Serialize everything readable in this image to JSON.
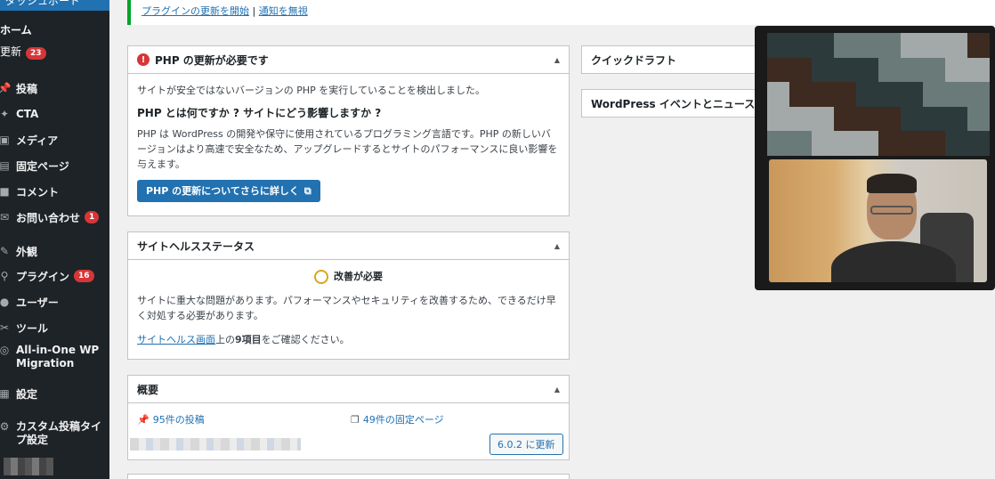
{
  "sidebar": {
    "top_label": "ダッシュボード",
    "home_label": "ホーム",
    "updates_label": "更新",
    "updates_count": "23",
    "items": [
      {
        "label": "投稿",
        "icon": "pin-icon",
        "glyph": "📌",
        "badge": ""
      },
      {
        "label": "CTA",
        "icon": "pin-icon",
        "glyph": "✦",
        "badge": ""
      },
      {
        "label": "メディア",
        "icon": "media-icon",
        "glyph": "▣",
        "badge": ""
      },
      {
        "label": "固定ページ",
        "icon": "page-icon",
        "glyph": "▤",
        "badge": ""
      },
      {
        "label": "コメント",
        "icon": "comment-icon",
        "glyph": "■",
        "badge": ""
      },
      {
        "label": "お問い合わせ",
        "icon": "mail-icon",
        "glyph": "✉",
        "badge": "1"
      },
      {
        "label": "外観",
        "icon": "brush-icon",
        "glyph": "✎",
        "badge": ""
      },
      {
        "label": "プラグイン",
        "icon": "plugin-icon",
        "glyph": "⚲",
        "badge": "16"
      },
      {
        "label": "ユーザー",
        "icon": "user-icon",
        "glyph": "●",
        "badge": ""
      },
      {
        "label": "ツール",
        "icon": "wrench-icon",
        "glyph": "✂",
        "badge": ""
      },
      {
        "label": "All-in-One WP",
        "label2": "Migration",
        "icon": "migration-icon",
        "glyph": "◎",
        "badge": ""
      },
      {
        "label": "設定",
        "icon": "settings-icon",
        "glyph": "▦",
        "badge": ""
      },
      {
        "label": "カスタム投稿タイ",
        "label2": "プ設定",
        "icon": "gear-icon",
        "glyph": "⚙",
        "badge": ""
      }
    ]
  },
  "notice": {
    "link1": "プラグインの更新を開始",
    "separator": "|",
    "link2": "通知を無視"
  },
  "php_box": {
    "title": "PHP の更新が必要です",
    "intro": "サイトが安全ではないバージョンの PHP を実行していることを検出しました。",
    "heading": "PHP とは何ですか ? サイトにどう影響しますか ?",
    "body": "PHP は WordPress の開発や保守に使用されているプログラミング言語です。PHP の新しいバージョンはより高速で安全なため、アップグレードするとサイトのパフォーマンスに良い影響を与えます。",
    "button": "PHP の更新についてさらに詳しく"
  },
  "health_box": {
    "title": "サイトヘルスステータス",
    "status": "改善が必要",
    "body": "サイトに重大な問題があります。パフォーマンスやセキュリティを改善するため、できるだけ早く対処する必要があります。",
    "link": "サイトヘルス画面",
    "suffix_pre": "上の",
    "count": "9項目",
    "suffix_post": "をご確認ください。"
  },
  "overview_box": {
    "title": "概要",
    "posts": "95件の投稿",
    "pages": "49件の固定ページ",
    "update_button": "6.0.2 に更新"
  },
  "quick_draft": {
    "title": "クイックドラフト"
  },
  "events": {
    "title": "WordPress イベントとニュース"
  },
  "colors": {
    "accent": "#2271b1",
    "badge": "#d63638",
    "notice_success": "#00a32a",
    "health_warning": "#dba617"
  }
}
